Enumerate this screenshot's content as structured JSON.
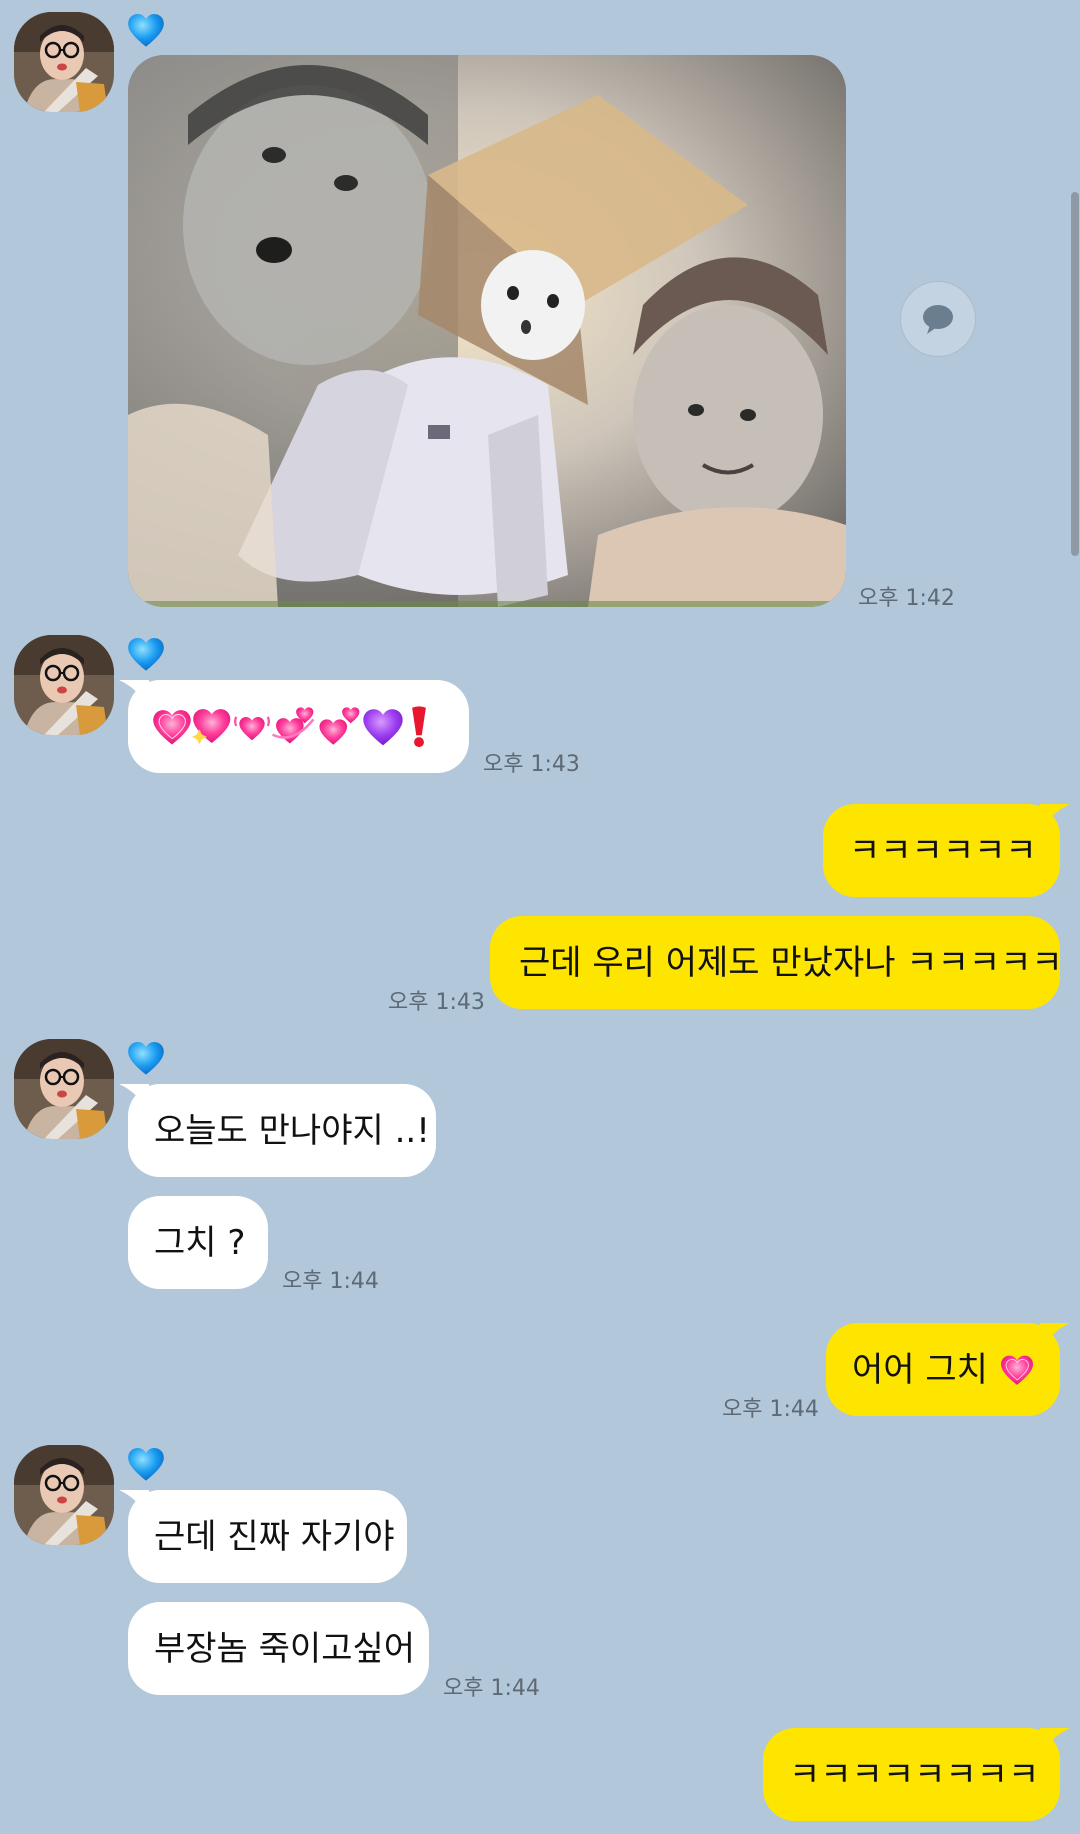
{
  "messages": [
    {
      "id": "m1",
      "sender": "them",
      "type": "photo",
      "time": "오후 1:42"
    },
    {
      "id": "m2",
      "sender": "them",
      "type": "emoji",
      "time": "오후 1:43"
    },
    {
      "id": "m3",
      "sender": "me",
      "text": "ㅋㅋㅋㅋㅋㅋ"
    },
    {
      "id": "m4",
      "sender": "me",
      "text": "근데 우리 어제도 만났자나 ㅋㅋㅋㅋㅋ",
      "time": "오후 1:43"
    },
    {
      "id": "m5",
      "sender": "them",
      "text": "오늘도 만나야지 ..!"
    },
    {
      "id": "m6",
      "sender": "them",
      "text": "그치 ?",
      "time": "오후 1:44"
    },
    {
      "id": "m7",
      "sender": "me",
      "text": "어어 그치",
      "time": "오후 1:44"
    },
    {
      "id": "m8",
      "sender": "them",
      "text": "근데 진짜 자기야"
    },
    {
      "id": "m9",
      "sender": "them",
      "text": "부장놈 죽이고싶어",
      "time": "오후 1:44"
    },
    {
      "id": "m10",
      "sender": "me",
      "text": "ㅋㅋㅋㅋㅋㅋㅋㅋ"
    }
  ],
  "icons": {
    "sender_name": "blue-heart-icon",
    "emoji_message": [
      "growing-heart-icon",
      "sparkling-heart-icon",
      "beating-heart-icon",
      "revolving-hearts-icon",
      "two-hearts-icon",
      "purple-heart-icon",
      "red-exclamation-icon"
    ],
    "reply_emoji": "growing-heart-icon",
    "photo_action": "speech-bubble-icon"
  },
  "colors": {
    "chat_background": "#b2c7da",
    "my_bubble": "#fee500",
    "their_bubble": "#ffffff",
    "timestamp": "#5d6a75"
  }
}
